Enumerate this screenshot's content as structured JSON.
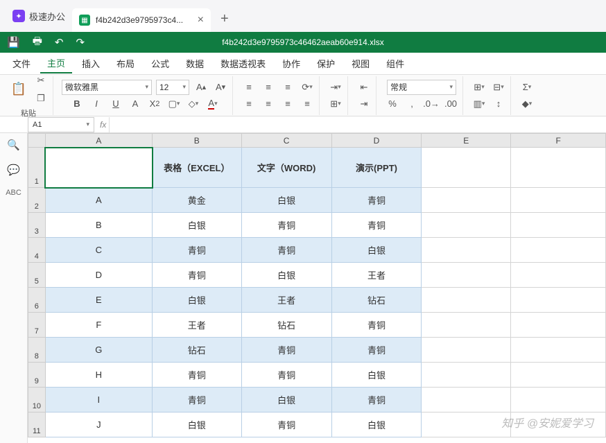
{
  "app": {
    "name": "极速办公",
    "tab_filename": "f4b242d3e9795973c4...",
    "doc_title": "f4b242d3e9795973c46462aeab60e914.xlsx"
  },
  "menu": {
    "items": [
      "文件",
      "主页",
      "插入",
      "布局",
      "公式",
      "数据",
      "数据透视表",
      "协作",
      "保护",
      "视图",
      "组件"
    ],
    "active": "主页"
  },
  "ribbon": {
    "paste": "粘贴",
    "font_name": "微软雅黑",
    "font_size": "12",
    "num_format": "常规"
  },
  "cellref": "A1",
  "columns": [
    "A",
    "B",
    "C",
    "D",
    "E",
    "F"
  ],
  "headers": {
    "b": "表格（EXCEL）",
    "c": "文字（WORD)",
    "d": "演示(PPT)"
  },
  "rows": [
    {
      "n": 2,
      "a": "A",
      "b": "黄金",
      "c": "白银",
      "d": "青铜",
      "cls": "even"
    },
    {
      "n": 3,
      "a": "B",
      "b": "白银",
      "c": "青铜",
      "d": "青铜",
      "cls": "odd"
    },
    {
      "n": 4,
      "a": "C",
      "b": "青铜",
      "c": "青铜",
      "d": "白银",
      "cls": "even"
    },
    {
      "n": 5,
      "a": "D",
      "b": "青铜",
      "c": "白银",
      "d": "王者",
      "cls": "odd"
    },
    {
      "n": 6,
      "a": "E",
      "b": "白银",
      "c": "王者",
      "d": "钻石",
      "cls": "even"
    },
    {
      "n": 7,
      "a": "F",
      "b": "王者",
      "c": "钻石",
      "d": "青铜",
      "cls": "odd"
    },
    {
      "n": 8,
      "a": "G",
      "b": "钻石",
      "c": "青铜",
      "d": "青铜",
      "cls": "even"
    },
    {
      "n": 9,
      "a": "H",
      "b": "青铜",
      "c": "青铜",
      "d": "白银",
      "cls": "odd"
    },
    {
      "n": 10,
      "a": "I",
      "b": "青铜",
      "c": "白银",
      "d": "青铜",
      "cls": "even"
    },
    {
      "n": 11,
      "a": "J",
      "b": "白银",
      "c": "青铜",
      "d": "白银",
      "cls": "odd"
    }
  ],
  "watermark": "知乎 @安妮爱学习"
}
